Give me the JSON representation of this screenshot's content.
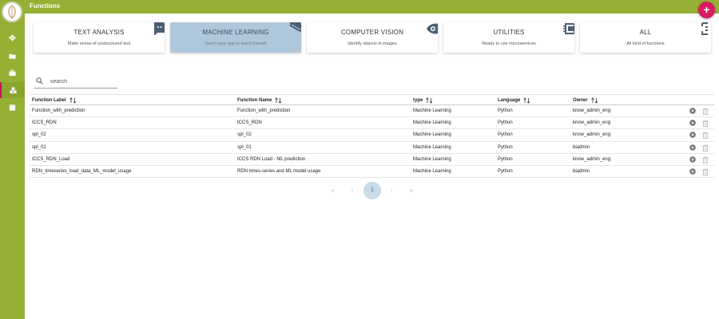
{
  "app": {
    "title": "Functions"
  },
  "fab": {
    "label": "+"
  },
  "sidebar": {
    "items": [
      {
        "icon": "gear-icon"
      },
      {
        "icon": "folder-icon"
      },
      {
        "icon": "briefcase-icon"
      },
      {
        "icon": "cubes-icon",
        "active": true
      },
      {
        "icon": "calendar-icon"
      }
    ],
    "accent": "#c2185b"
  },
  "categories": [
    {
      "title": "TEXT ANALYSIS",
      "subtitle": "Make sense of unstructured text",
      "icon": "chat-bubble-icon"
    },
    {
      "title": "MACHINE LEARNING",
      "subtitle": "Teach your app to teach himself",
      "icon": "brain-icon",
      "active": true
    },
    {
      "title": "COMPUTER VISION",
      "subtitle": "Identify objects in images",
      "icon": "eye-icon"
    },
    {
      "title": "UTILITIES",
      "subtitle": "Ready to use microservices",
      "icon": "chip-icon"
    },
    {
      "title": "ALL",
      "subtitle": "All kind of functions",
      "icon": "grid-icon"
    }
  ],
  "search": {
    "placeholder": "search",
    "value": ""
  },
  "table": {
    "columns": [
      "Function Label",
      "Function Name",
      "type",
      "Language",
      "Owner"
    ],
    "rows": [
      [
        "Function_with_prediction",
        "Function_with_prediction",
        "Machine Learning",
        "Python",
        "know_admin_eng"
      ],
      [
        "ICCS_RDN",
        "ICCS_RDN",
        "Machine Learning",
        "Python",
        "know_admin_eng"
      ],
      [
        "spl_02",
        "spl_02",
        "Machine Learning",
        "Python",
        "know_admin_eng"
      ],
      [
        "spl_01",
        "spl_01",
        "Machine Learning",
        "Python",
        "biadmin"
      ],
      [
        "ICCS_RDN_Load",
        "ICCS RDN Load - ML prediction",
        "Machine Learning",
        "Python",
        "know_admin_eng"
      ],
      [
        "RDN_timeseries_load_data_ML_model_usage",
        "RDN times-series and ML model usage",
        "Machine Learning",
        "Python",
        "biadmin"
      ]
    ]
  },
  "pagination": {
    "first": "«",
    "prev": "‹",
    "current": "1",
    "next": "›",
    "last": "»"
  },
  "colors": {
    "primary": "#95b033",
    "accent": "#d81b60",
    "selected_card": "#afc7db"
  }
}
